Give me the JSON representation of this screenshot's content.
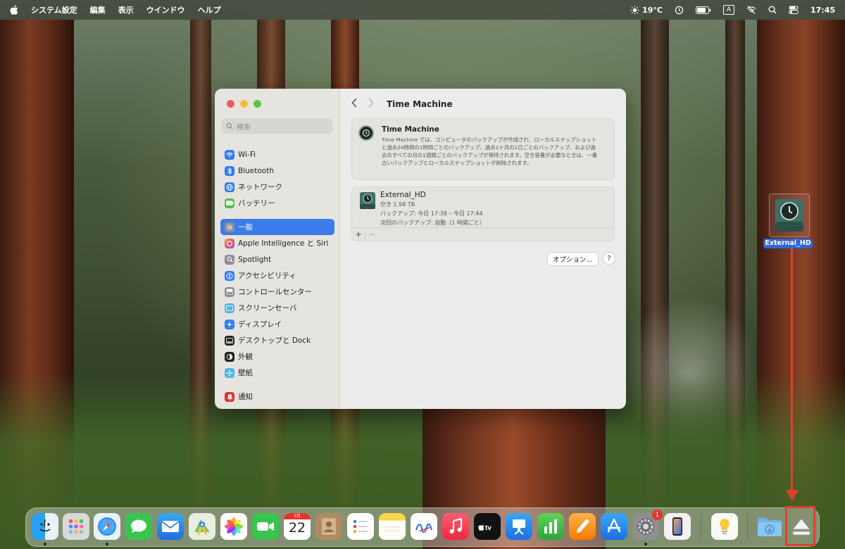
{
  "menubar": {
    "app": "システム設定",
    "menus": [
      "編集",
      "表示",
      "ウインドウ",
      "ヘルプ"
    ],
    "temperature": "19°C",
    "input_mode": "A",
    "time": "17:45"
  },
  "window": {
    "title": "Time Machine",
    "search_placeholder": "検索",
    "sidebar": {
      "items": [
        {
          "label": "Wi-Fi",
          "icon": "wifi-icon",
          "color": "#2f7cf6"
        },
        {
          "label": "Bluetooth",
          "icon": "bluetooth-icon",
          "color": "#2f7cf6"
        },
        {
          "label": "ネットワーク",
          "icon": "globe-icon",
          "color": "#2f7cf6"
        },
        {
          "label": "バッテリー",
          "icon": "battery-icon",
          "color": "#4cc24a"
        },
        {
          "label": "一般",
          "icon": "gear-icon",
          "color": "#8e8e93",
          "selected": true
        },
        {
          "label": "Apple Intelligence と Siri",
          "icon": "siri-icon",
          "color": "#e0597a"
        },
        {
          "label": "Spotlight",
          "icon": "spotlight-icon",
          "color": "#8e8e93"
        },
        {
          "label": "アクセシビリティ",
          "icon": "accessibility-icon",
          "color": "#2f7cf6"
        },
        {
          "label": "コントロールセンター",
          "icon": "control-center-icon",
          "color": "#8e8e93"
        },
        {
          "label": "スクリーンセーバ",
          "icon": "screensaver-icon",
          "color": "#4fb5e8"
        },
        {
          "label": "ディスプレイ",
          "icon": "display-icon",
          "color": "#2f7cf6"
        },
        {
          "label": "デスクトップと Dock",
          "icon": "dock-icon",
          "color": "#222222"
        },
        {
          "label": "外観",
          "icon": "appearance-icon",
          "color": "#222222"
        },
        {
          "label": "壁紙",
          "icon": "wallpaper-icon",
          "color": "#4fb5e8"
        },
        {
          "label": "通知",
          "icon": "notifications-icon",
          "color": "#e5342a"
        }
      ]
    },
    "tm_card": {
      "title": "Time Machine",
      "description": "Time Machine では、コンピュータのバックアップが作成され、ローカルスナップショットと過去24時間の1時間ごとのバックアップ、過去1ヶ月の1日ごとのバックアップ、および過去のすべての月の1週間ごとのバックアップが保持されます。空き容量が必要なときは、一番古いバックアップとローカルスナップショットが削除されます。"
    },
    "disk_card": {
      "name": "External_HD",
      "free": "空き 1.98 TB",
      "backup": "バックアップ: 今日 17:38 – 今日 17:44",
      "next_backup": "次回のバックアップ: 自動（1 時間ごと）",
      "add_label": "+",
      "remove_label": "−"
    },
    "options_label": "オプション...",
    "help_label": "?"
  },
  "desktop": {
    "volume_label": "External_HD"
  },
  "dock": {
    "calendar_month": "3月",
    "calendar_day": "22",
    "settings_badge": "1"
  }
}
